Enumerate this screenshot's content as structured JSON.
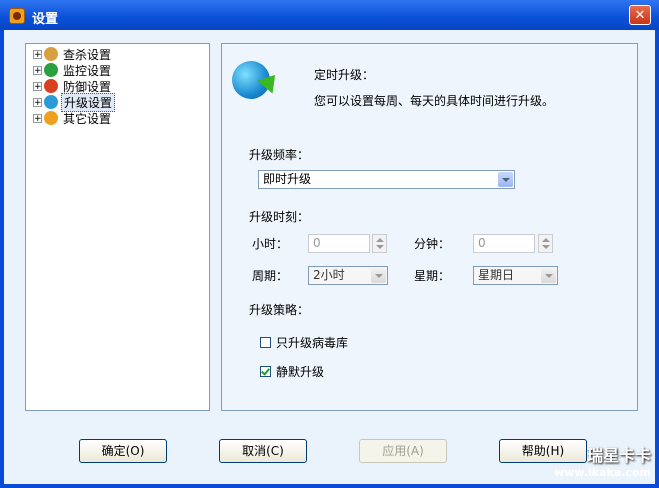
{
  "window": {
    "title": "设置",
    "close_symbol": "✕"
  },
  "tree": {
    "items": [
      {
        "label": "查杀设置",
        "icon": "search-icon",
        "color": "#d8a040"
      },
      {
        "label": "监控设置",
        "icon": "umbrella-icon",
        "color": "#2aa040"
      },
      {
        "label": "防御设置",
        "icon": "shield-icon",
        "color": "#d84020"
      },
      {
        "label": "升级设置",
        "icon": "globe-icon",
        "color": "#2a9ad8",
        "selected": true
      },
      {
        "label": "其它设置",
        "icon": "gear-icon",
        "color": "#f0a020"
      }
    ]
  },
  "header": {
    "title": "定时升级：",
    "description": "您可以设置每周、每天的具体时间进行升级。"
  },
  "frequency": {
    "label": "升级频率：",
    "value": "即时升级"
  },
  "time": {
    "label": "升级时刻：",
    "hour_label": "小时：",
    "hour_value": "0",
    "minute_label": "分钟：",
    "minute_value": "0",
    "period_label": "周期：",
    "period_value": "2小时",
    "weekday_label": "星期：",
    "weekday_value": "星期日"
  },
  "strategy": {
    "label": "升级策略：",
    "virus_only": {
      "label": "只升级病毒库",
      "checked": false
    },
    "silent": {
      "label": "静默升级",
      "checked": true
    }
  },
  "buttons": {
    "ok": "确定(O)",
    "cancel": "取消(C)",
    "apply": "应用(A)",
    "help": "帮助(H)"
  },
  "watermark": {
    "line1": "瑞星卡卡",
    "line2": "www.ikaka.com"
  }
}
